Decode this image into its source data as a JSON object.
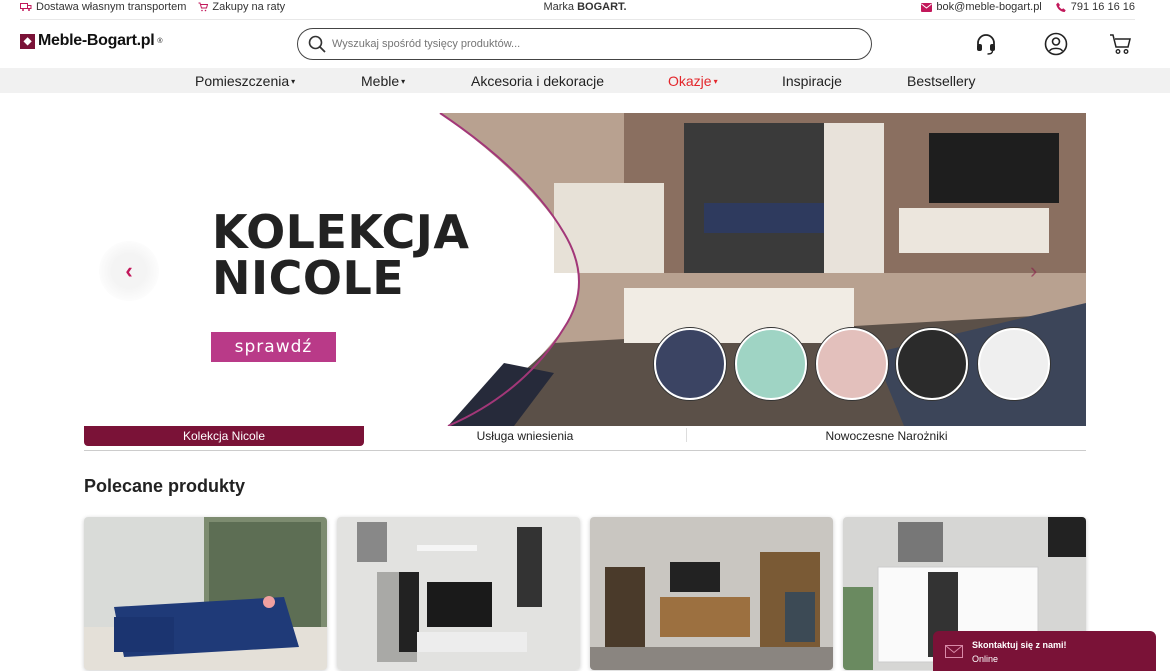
{
  "topbar": {
    "delivery": "Dostawa własnym transportem",
    "installments": "Zakupy na raty",
    "brand_prefix": "Marka ",
    "brand_name": "BOGART.",
    "email": "bok@meble-bogart.pl",
    "phone": "791 16 16 16"
  },
  "header": {
    "logo": "Meble-Bogart.pl",
    "logo_reg": "®",
    "search_placeholder": "Wyszukaj spośród tysięcy produktów..."
  },
  "nav": {
    "items": [
      {
        "label": "Pomieszczenia",
        "caret": "▾"
      },
      {
        "label": "Meble",
        "caret": "▾"
      },
      {
        "label": "Akcesoria i dekoracje",
        "caret": ""
      },
      {
        "label": "Okazje",
        "caret": "▾"
      },
      {
        "label": "Inspiracje",
        "caret": ""
      },
      {
        "label": "Bestsellery",
        "caret": ""
      }
    ],
    "highlight_color": "#e3262b"
  },
  "hero": {
    "title_line1": "KOLEKCJA",
    "title_line2": "NICOLE",
    "cta": "sprawdź",
    "swatches": [
      "#3b4463",
      "#9fd4c4",
      "#e3c0bc",
      "#2b2b2b",
      "#efefef"
    ]
  },
  "tabs": [
    "Kolekcja Nicole",
    "Usługa wniesienia",
    "Nowoczesne Narożniki"
  ],
  "section": {
    "title": "Polecane produkty"
  },
  "chat": {
    "title": "Skontaktuj się z nami!",
    "status": "Online"
  },
  "colors": {
    "brand": "#7a1237",
    "accent": "#b93a88"
  }
}
